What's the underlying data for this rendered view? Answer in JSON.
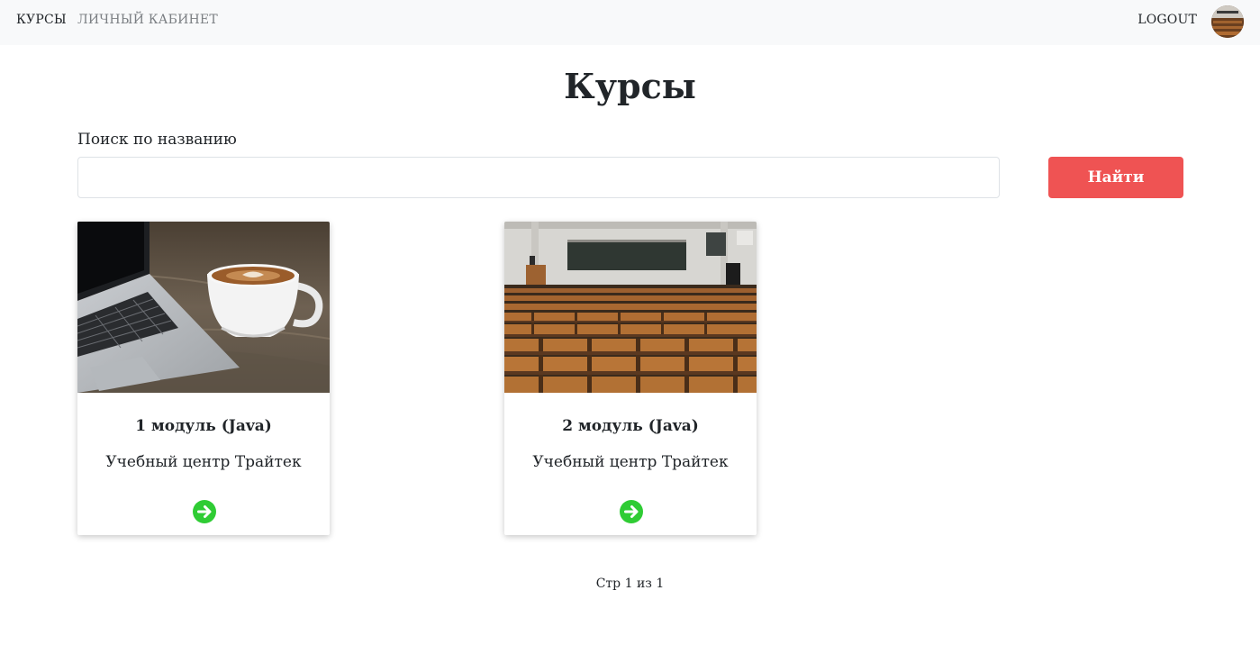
{
  "nav": {
    "courses": "КУРСЫ",
    "cabinet": "ЛИЧНЫЙ КАБИНЕТ",
    "logout": "LOGOUT"
  },
  "page": {
    "title": "Курсы"
  },
  "search": {
    "label": "Поиск по названию",
    "value": "",
    "placeholder": "",
    "button": "Найти"
  },
  "courses": [
    {
      "title": "1 модуль (Java)",
      "subtitle": "Учебный центр Трайтек",
      "image": "laptop-coffee-photo",
      "icon": "arrow-right-circle-icon"
    },
    {
      "title": "2 модуль (Java)",
      "subtitle": "Учебный центр Трайтек",
      "image": "lecture-hall-photo",
      "icon": "arrow-right-circle-icon"
    }
  ],
  "pagination": {
    "text": "Стр 1 из 1"
  },
  "colors": {
    "primary_button": "#ef5353",
    "arrow": "#2fcc34",
    "navbar": "#f8f9fa"
  }
}
